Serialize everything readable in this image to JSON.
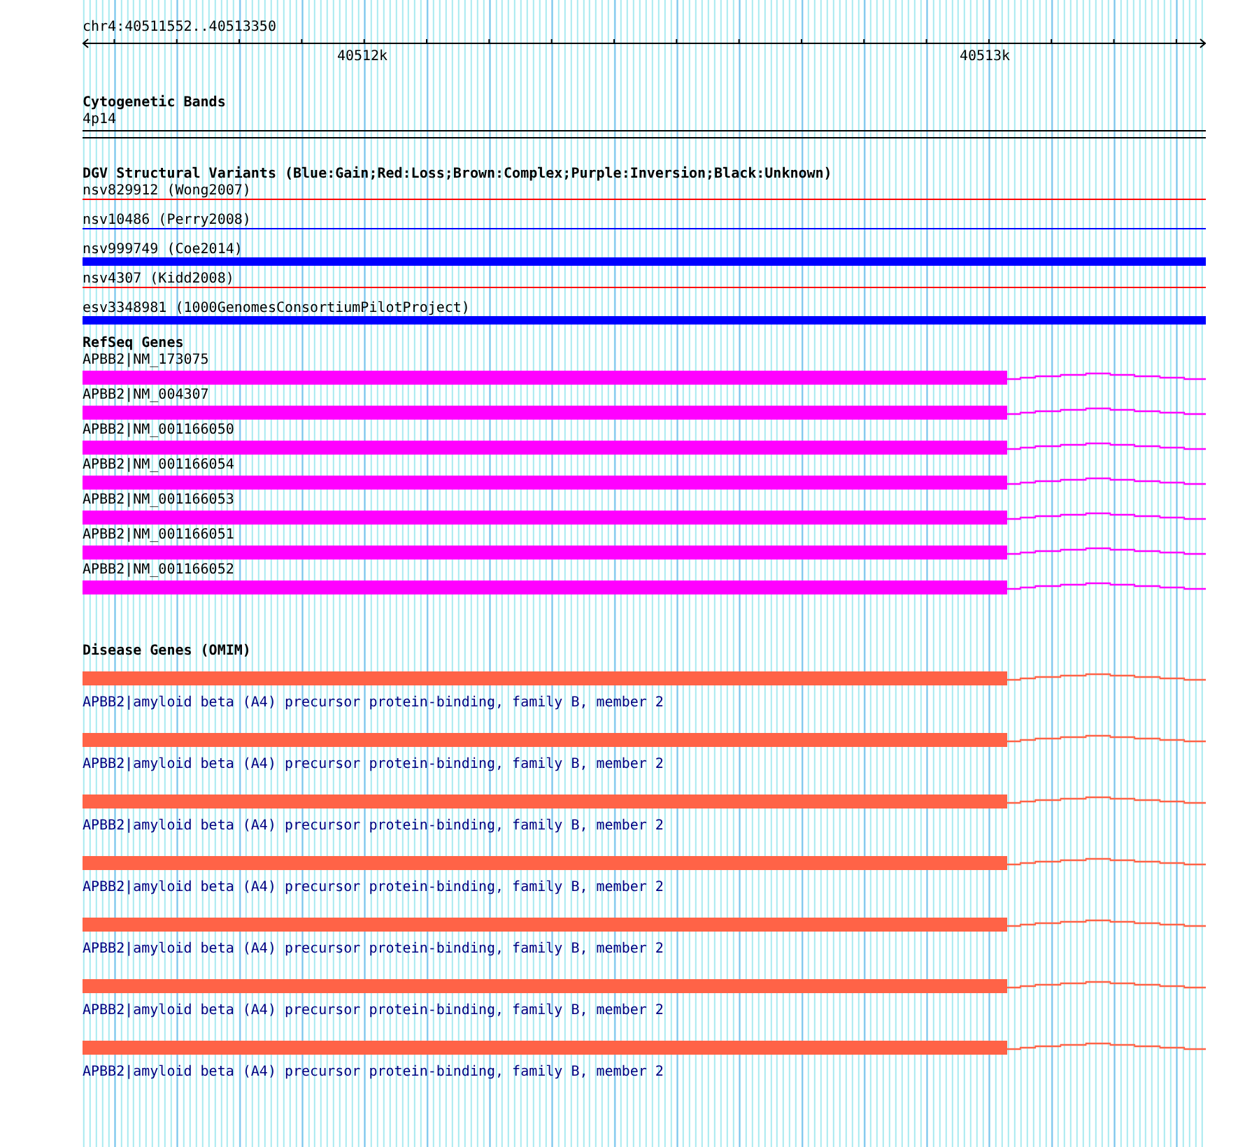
{
  "ruler": {
    "location": "chr4:40511552..40513350",
    "tick_labels": [
      "40512k",
      "40513k"
    ]
  },
  "cytogenetic_bands": {
    "title": "Cytogenetic Bands",
    "band": "4p14"
  },
  "dgv": {
    "title": "DGV Structural Variants (Blue:Gain;Red:Loss;Brown:Complex;Purple:Inversion;Black:Unknown)",
    "variants": [
      {
        "label": "nsv829912 (Wong2007)",
        "color": "#ff0000",
        "kind": "thin"
      },
      {
        "label": "nsv10486 (Perry2008)",
        "color": "#0000ff",
        "kind": "thin"
      },
      {
        "label": "nsv999749 (Coe2014)",
        "color": "#0000ff",
        "kind": "thick"
      },
      {
        "label": "nsv4307 (Kidd2008)",
        "color": "#ff0000",
        "kind": "thin"
      },
      {
        "label": "esv3348981 (1000GenomesConsortiumPilotProject)",
        "color": "#0000ff",
        "kind": "thick"
      }
    ]
  },
  "refseq": {
    "title": "RefSeq Genes",
    "genes": [
      {
        "label": "APBB2|NM_173075"
      },
      {
        "label": "APBB2|NM_004307"
      },
      {
        "label": "APBB2|NM_001166050"
      },
      {
        "label": "APBB2|NM_001166054"
      },
      {
        "label": "APBB2|NM_001166053"
      },
      {
        "label": "APBB2|NM_001166051"
      },
      {
        "label": "APBB2|NM_001166052"
      }
    ]
  },
  "omim": {
    "title": "Disease Genes (OMIM)",
    "genes": [
      {
        "label": "APBB2|amyloid beta (A4) precursor protein-binding, family B, member 2"
      },
      {
        "label": "APBB2|amyloid beta (A4) precursor protein-binding, family B, member 2"
      },
      {
        "label": "APBB2|amyloid beta (A4) precursor protein-binding, family B, member 2"
      },
      {
        "label": "APBB2|amyloid beta (A4) precursor protein-binding, family B, member 2"
      },
      {
        "label": "APBB2|amyloid beta (A4) precursor protein-binding, family B, member 2"
      },
      {
        "label": "APBB2|amyloid beta (A4) precursor protein-binding, family B, member 2"
      },
      {
        "label": "APBB2|amyloid beta (A4) precursor protein-binding, family B, member 2"
      }
    ]
  }
}
